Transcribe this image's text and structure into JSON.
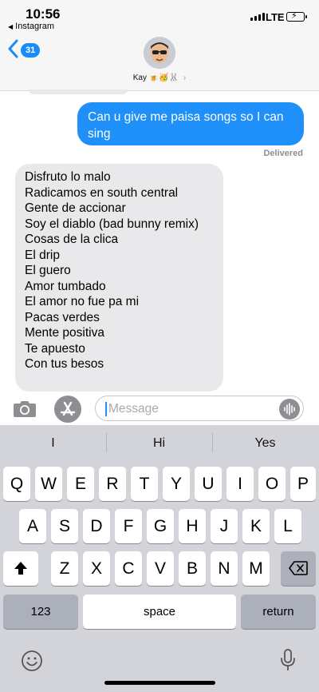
{
  "status_bar": {
    "time": "10:56",
    "back_app": "Instagram",
    "network": "LTE"
  },
  "header": {
    "unread_count": "31",
    "contact_name": "Kay",
    "contact_emoji": "🍺🥳🐰"
  },
  "messages": {
    "outgoing": "Can u give me paisa songs so I can sing",
    "status": "Delivered",
    "incoming_lines": [
      "Disfruto lo malo",
      "Radicamos en south central",
      "Gente de accionar",
      "Soy el diablo (bad bunny remix)",
      "Cosas de la clica",
      "El drip",
      "El guero",
      "Amor tumbado",
      "El amor no fue pa mi",
      "Pacas verdes",
      "Mente positiva",
      "Te apuesto",
      "Con tus besos"
    ]
  },
  "input": {
    "placeholder": "Message"
  },
  "keyboard": {
    "suggestions": [
      "I",
      "Hi",
      "Yes"
    ],
    "row1": [
      "Q",
      "W",
      "E",
      "R",
      "T",
      "Y",
      "U",
      "I",
      "O",
      "P"
    ],
    "row2": [
      "A",
      "S",
      "D",
      "F",
      "G",
      "H",
      "J",
      "K",
      "L"
    ],
    "row3": [
      "Z",
      "X",
      "C",
      "V",
      "B",
      "N",
      "M"
    ],
    "numbers_label": "123",
    "space_label": "space",
    "return_label": "return"
  },
  "colors": {
    "accent": "#1f8ff9",
    "incoming_bubble": "#e9e9eb",
    "keyboard_bg": "#d2d4da"
  }
}
